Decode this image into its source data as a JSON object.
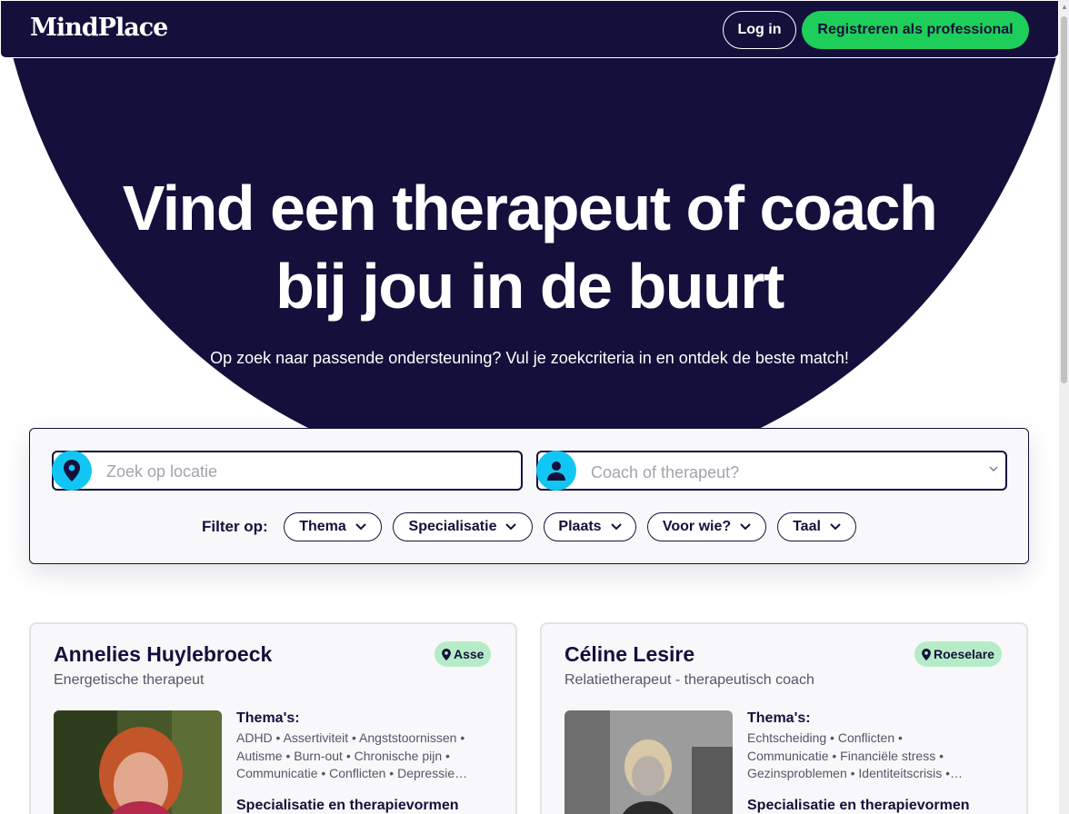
{
  "header": {
    "logo": "MindPlace",
    "login_label": "Log in",
    "register_label": "Registreren als professional"
  },
  "hero": {
    "title_line1": "Vind een therapeut of coach",
    "title_line2": "bij jou in de buurt",
    "subtitle": "Op zoek naar passende ondersteuning? Vul je zoekcriteria in en ontdek de beste match!"
  },
  "search": {
    "location_placeholder": "Zoek op locatie",
    "coach_placeholder": "Coach of therapeut?",
    "filter_label": "Filter op:",
    "filters": [
      "Thema",
      "Specialisatie",
      "Plaats",
      "Voor wie?",
      "Taal"
    ]
  },
  "cards": [
    {
      "name": "Annelies Huylebroeck",
      "role": "Energetische therapeut",
      "location": "Asse",
      "themes_title": "Thema's:",
      "themes_line1": "ADHD • Assertiviteit • Angststoornissen •",
      "themes_line2": "Autisme • Burn-out • Chronische pijn •",
      "themes_line3": "Communicatie • Conflicten • Depressie…",
      "spec_title": "Specialisatie en therapievormen"
    },
    {
      "name": "Céline  Lesire",
      "role": "Relatietherapeut - therapeutisch coach",
      "location": "Roeselare",
      "themes_title": "Thema's:",
      "themes_line1": "Echtscheiding • Conflicten •",
      "themes_line2": "Communicatie • Financiële stress •",
      "themes_line3": "Gezinsproblemen • Identiteitscrisis •…",
      "spec_title": "Specialisatie en therapievormen"
    }
  ],
  "colors": {
    "navy": "#14103b",
    "green": "#1dcf5a",
    "cyan": "#12c6f3",
    "location_badge": "#b5ecc7"
  }
}
